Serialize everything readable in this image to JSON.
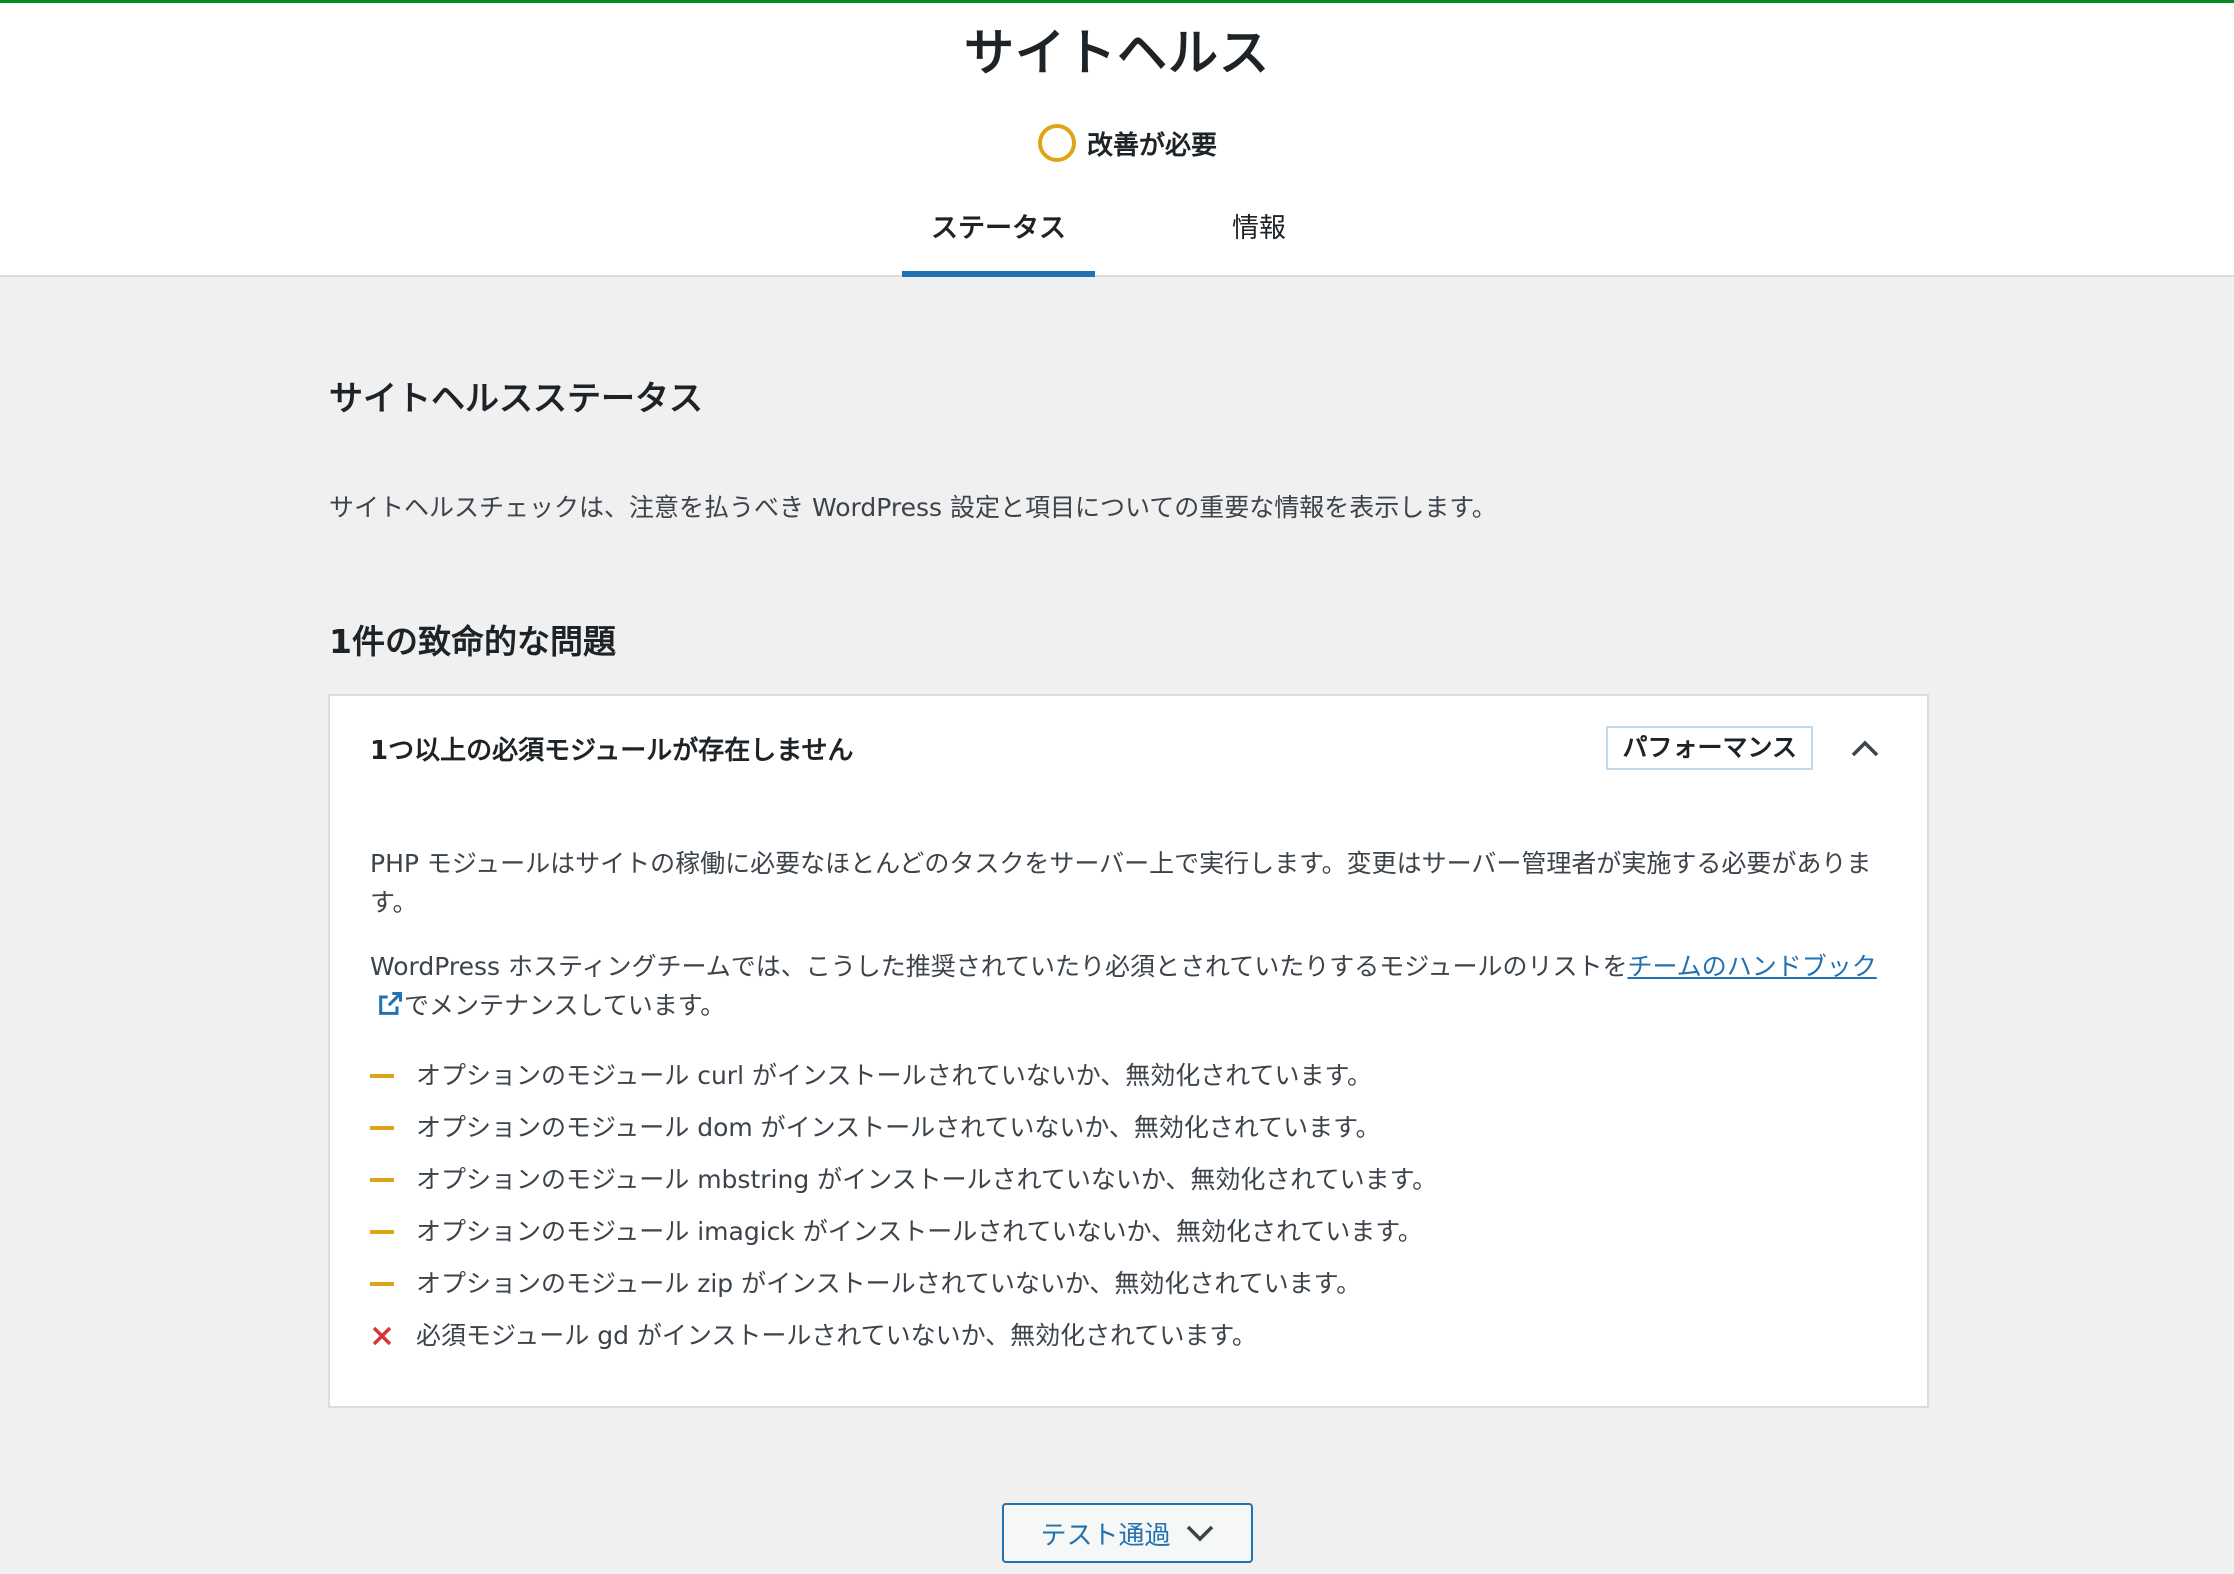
{
  "header": {
    "title": "サイトヘルス",
    "status_label": "改善が必要",
    "status_color": "#dba617",
    "tabs": [
      {
        "label": "ステータス",
        "active": true
      },
      {
        "label": "情報",
        "active": false
      }
    ]
  },
  "main": {
    "section_title": "サイトヘルスステータス",
    "intro": "サイトヘルスチェックは、注意を払うべき WordPress 設定と項目についての重要な情報を表示します。",
    "issues_count": "1件の致命的な問題",
    "issue": {
      "title": "1つ以上の必須モジュールが存在しません",
      "badge": "パフォーマンス",
      "paragraph1": "PHP モジュールはサイトの稼働に必要なほとんどのタスクをサーバー上で実行します。変更はサーバー管理者が実施する必要があります。",
      "paragraph2_before": "WordPress ホスティングチームでは、こうした推奨されていたり必須とされていたりするモジュールのリストを",
      "paragraph2_link": "チームのハンドブック",
      "paragraph2_after": "でメンテナンスしています。",
      "modules": [
        {
          "text": "オプションのモジュール curl がインストールされていないか、無効化されています。",
          "severity": "warning"
        },
        {
          "text": "オプションのモジュール dom がインストールされていないか、無効化されています。",
          "severity": "warning"
        },
        {
          "text": "オプションのモジュール mbstring がインストールされていないか、無効化されています。",
          "severity": "warning"
        },
        {
          "text": "オプションのモジュール imagick がインストールされていないか、無効化されています。",
          "severity": "warning"
        },
        {
          "text": "オプションのモジュール zip がインストールされていないか、無効化されています。",
          "severity": "warning"
        },
        {
          "text": "必須モジュール gd がインストールされていないか、無効化されています。",
          "severity": "error"
        }
      ]
    },
    "passed_button": "テスト通過"
  },
  "colors": {
    "accent": "#2271b1",
    "warning": "#dba617",
    "error": "#d63638",
    "top_line": "#008a20"
  }
}
